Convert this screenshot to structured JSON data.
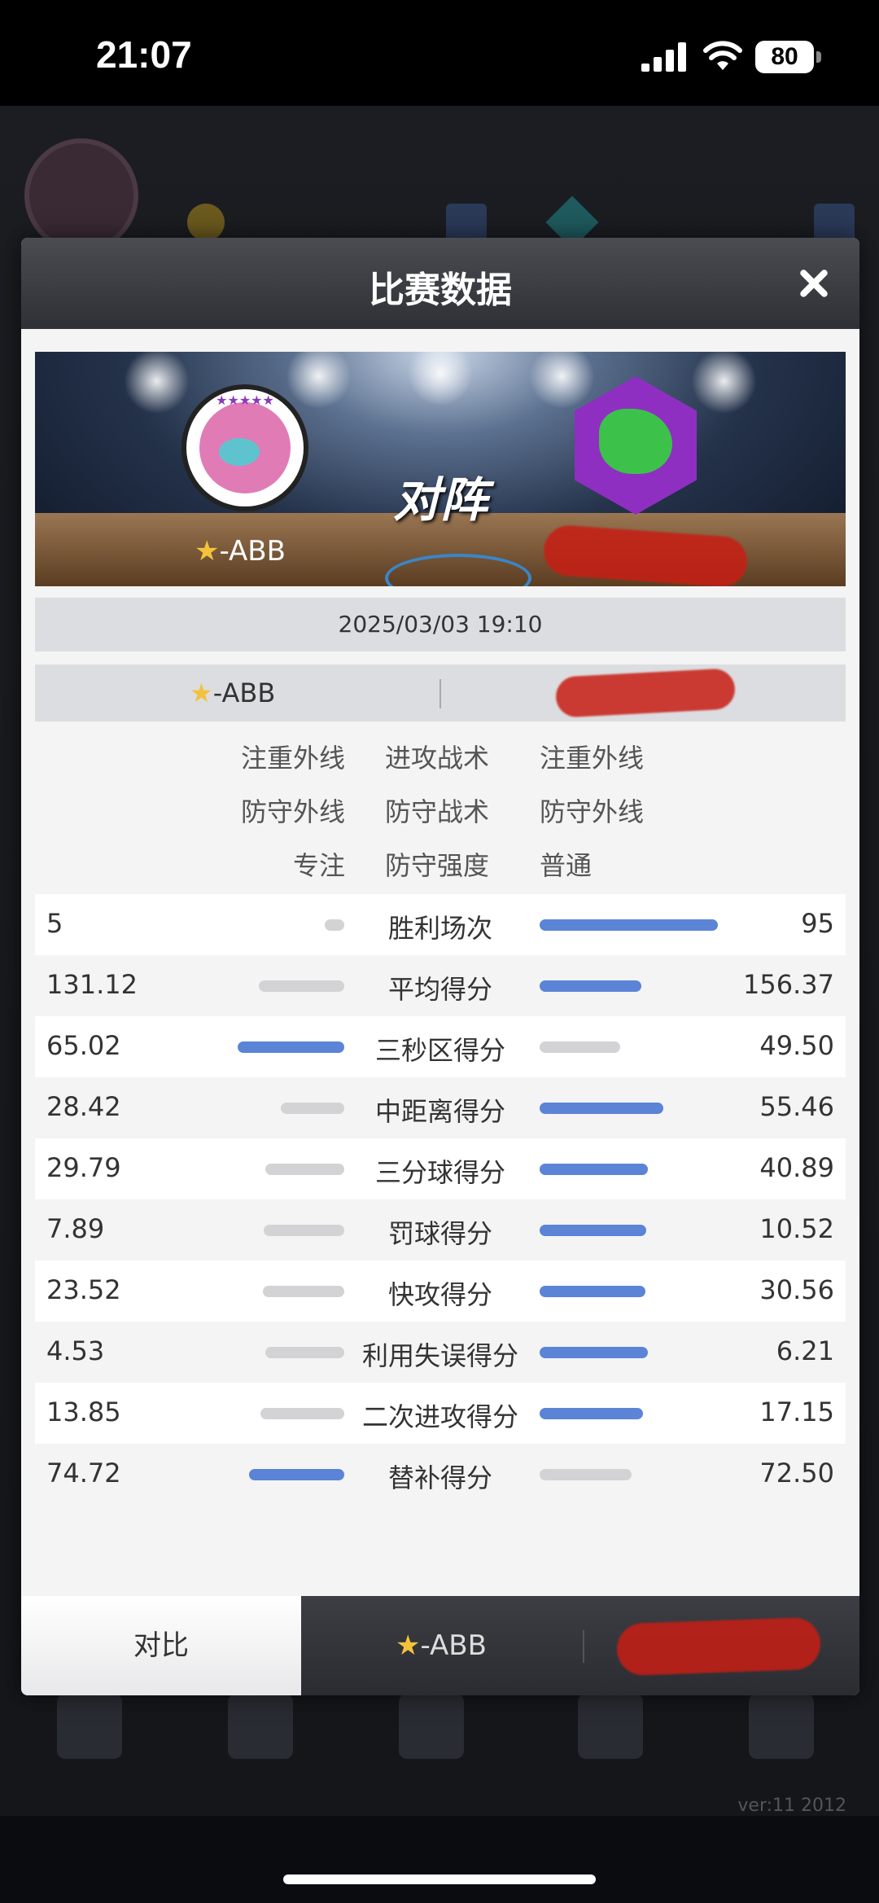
{
  "status_bar": {
    "time": "21:07",
    "battery": "80"
  },
  "background": {
    "version": "ver:11  2012"
  },
  "modal": {
    "title": "比赛数据",
    "vs_text": "对阵",
    "left_team": "-ABB",
    "date": "2025/03/03 19:10",
    "team_bar_left": "-ABB"
  },
  "tactics": [
    {
      "left": "注重外线",
      "label": "进攻战术",
      "right": "注重外线"
    },
    {
      "left": "防守外线",
      "label": "防守战术",
      "right": "防守外线"
    },
    {
      "left": "专注",
      "label": "防守强度",
      "right": "普通"
    }
  ],
  "stats": [
    {
      "label": "胜利场次",
      "left": "5",
      "right": "95",
      "left_value": 5,
      "right_value": 95,
      "higher": "right"
    },
    {
      "label": "平均得分",
      "left": "131.12",
      "right": "156.37",
      "left_value": 131.12,
      "right_value": 156.37,
      "higher": "right"
    },
    {
      "label": "三秒区得分",
      "left": "65.02",
      "right": "49.50",
      "left_value": 65.02,
      "right_value": 49.5,
      "higher": "left"
    },
    {
      "label": "中距离得分",
      "left": "28.42",
      "right": "55.46",
      "left_value": 28.42,
      "right_value": 55.46,
      "higher": "right"
    },
    {
      "label": "三分球得分",
      "left": "29.79",
      "right": "40.89",
      "left_value": 29.79,
      "right_value": 40.89,
      "higher": "right"
    },
    {
      "label": "罚球得分",
      "left": "7.89",
      "right": "10.52",
      "left_value": 7.89,
      "right_value": 10.52,
      "higher": "right"
    },
    {
      "label": "快攻得分",
      "left": "23.52",
      "right": "30.56",
      "left_value": 23.52,
      "right_value": 30.56,
      "higher": "right"
    },
    {
      "label": "利用失误得分",
      "left": "4.53",
      "right": "6.21",
      "left_value": 4.53,
      "right_value": 6.21,
      "higher": "right"
    },
    {
      "label": "二次进攻得分",
      "left": "13.85",
      "right": "17.15",
      "left_value": 13.85,
      "right_value": 17.15,
      "higher": "right"
    },
    {
      "label": "替补得分",
      "left": "74.72",
      "right": "72.50",
      "left_value": 74.72,
      "right_value": 72.5,
      "higher": "left"
    }
  ],
  "tabs": {
    "compare": "对比",
    "team_left": "-ABB"
  },
  "colors": {
    "winner_bar": "#5b84d6",
    "loser_bar": "#d3d3d6",
    "star": "#f3c23d"
  }
}
